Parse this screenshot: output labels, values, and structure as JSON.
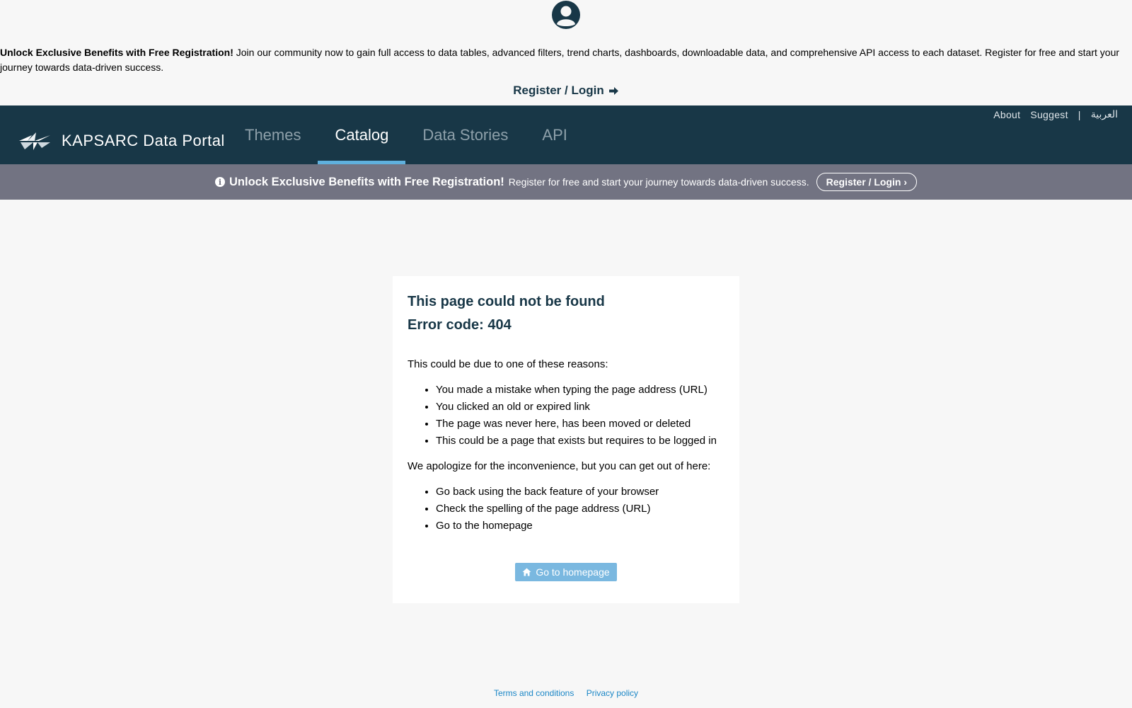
{
  "promo": {
    "heading": "Unlock Exclusive Benefits with Free Registration!",
    "body": "Join our community now to gain full access to data tables, advanced filters, trend charts, dashboards, downloadable data, and comprehensive API access to each dataset. Register for free and start your journey towards data-driven success.",
    "link_label": "Register / Login"
  },
  "header": {
    "brand": "KAPSARC Data Portal",
    "top_links": [
      "About",
      "Suggest",
      "|",
      "العربية"
    ],
    "nav": [
      {
        "label": "Themes",
        "active": false
      },
      {
        "label": "Catalog",
        "active": true
      },
      {
        "label": "Data Stories",
        "active": false
      },
      {
        "label": "API",
        "active": false
      }
    ]
  },
  "banner": {
    "title": "Unlock Exclusive Benefits with Free Registration!",
    "subtitle": "Register for free and start your journey towards data-driven success.",
    "button_label": "Register / Login"
  },
  "error": {
    "title": "This page could not be found",
    "code": "Error code: 404",
    "reasons_intro": "This could be due to one of these reasons:",
    "reasons": [
      "You made a mistake when typing the page address (URL)",
      "You clicked an old or expired link",
      "The page was never here, has been moved or deleted",
      "This could be a page that exists but requires to be logged in"
    ],
    "apology": "We apologize for the inconvenience, but you can get out of here:",
    "ways": [
      "Go back using the back feature of your browser",
      "Check the spelling of the page address (URL)",
      "Go to the homepage"
    ],
    "home_button": "Go to homepage"
  },
  "footer": {
    "terms": "Terms and conditions",
    "privacy": "Privacy policy"
  },
  "colors": {
    "header_bg": "#183747",
    "banner_bg": "#727382",
    "accent": "#5fb0dd",
    "button_bg": "#7ab8e0",
    "link": "#1a86c6"
  }
}
